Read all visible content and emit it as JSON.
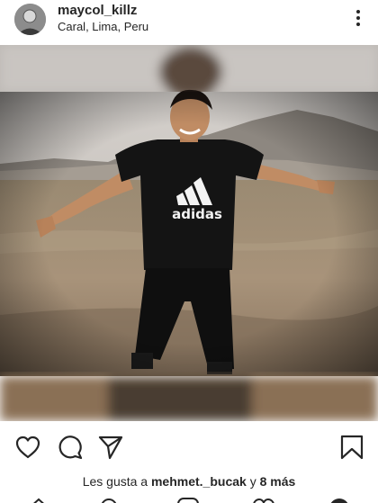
{
  "post": {
    "username": "maycol_killz",
    "location": "Caral, Lima, Peru",
    "shirt_brand": "adidas"
  },
  "likes": {
    "prefix": "Les gusta a",
    "user": "mehmet._bucak",
    "joiner": "y",
    "others": "8 más"
  },
  "icons": {
    "more": "more-vertical-icon",
    "like": "heart-icon",
    "comment": "comment-icon",
    "share": "paper-plane-icon",
    "save": "bookmark-icon",
    "nav": [
      "home-icon",
      "search-icon",
      "add-post-icon",
      "activity-heart-icon",
      "profile-icon"
    ]
  },
  "colors": {
    "text": "#262626",
    "background": "#ffffff"
  }
}
